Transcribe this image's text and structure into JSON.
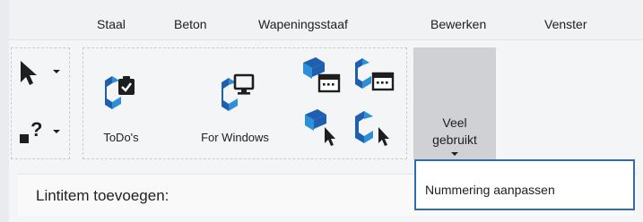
{
  "ribbon_tabs": [
    "Staal",
    "Beton",
    "Wapeningsstaaf",
    "Bewerken",
    "Venster"
  ],
  "buttons": {
    "todos_label": "ToDo's",
    "for_windows_label": "For Windows",
    "veel_gebruikt_line1": "Veel",
    "veel_gebruikt_line2": "gebruikt"
  },
  "dropdown": {
    "item": "Nummering aanpassen"
  },
  "add_item": {
    "label": "Lintitem toevoegen:"
  },
  "colors": {
    "brand_blue": "#1f5fb0",
    "accent_blue": "#2b8fd9",
    "dark": "#1e1e1e",
    "selected_bg": "#cfd1d4",
    "popup_border": "#2f6bb0"
  },
  "icons": [
    "pointer-arrow-icon",
    "help-pointer-icon",
    "tekla-todo-icon",
    "tekla-for-windows-icon",
    "window-cursor-icon",
    "tekla-window-icon",
    "chevron-cursor-icon",
    "tekla-cursor-icon",
    "dropdown-caret-icon"
  ]
}
